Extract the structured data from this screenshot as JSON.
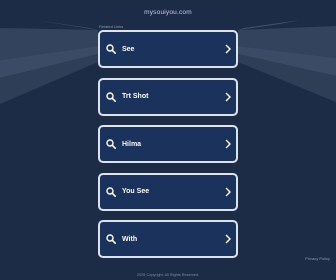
{
  "header": {
    "domain": "mysouiyou.com",
    "related_label": "Related Links"
  },
  "links": [
    {
      "label": "See",
      "icon": "search-icon"
    },
    {
      "label": "Trt Shot",
      "icon": "search-icon"
    },
    {
      "label": "Hilma",
      "icon": "search-icon"
    },
    {
      "label": "You See",
      "icon": "search-icon"
    },
    {
      "label": "With",
      "icon": "search-icon"
    }
  ],
  "footer": {
    "privacy_label": "Privacy Policy",
    "copyright": "2025 Copyright. All Rights Reserved."
  },
  "colors": {
    "background": "#1c2c47",
    "link_fill": "#1b325c",
    "link_border": "#dde3ec"
  }
}
